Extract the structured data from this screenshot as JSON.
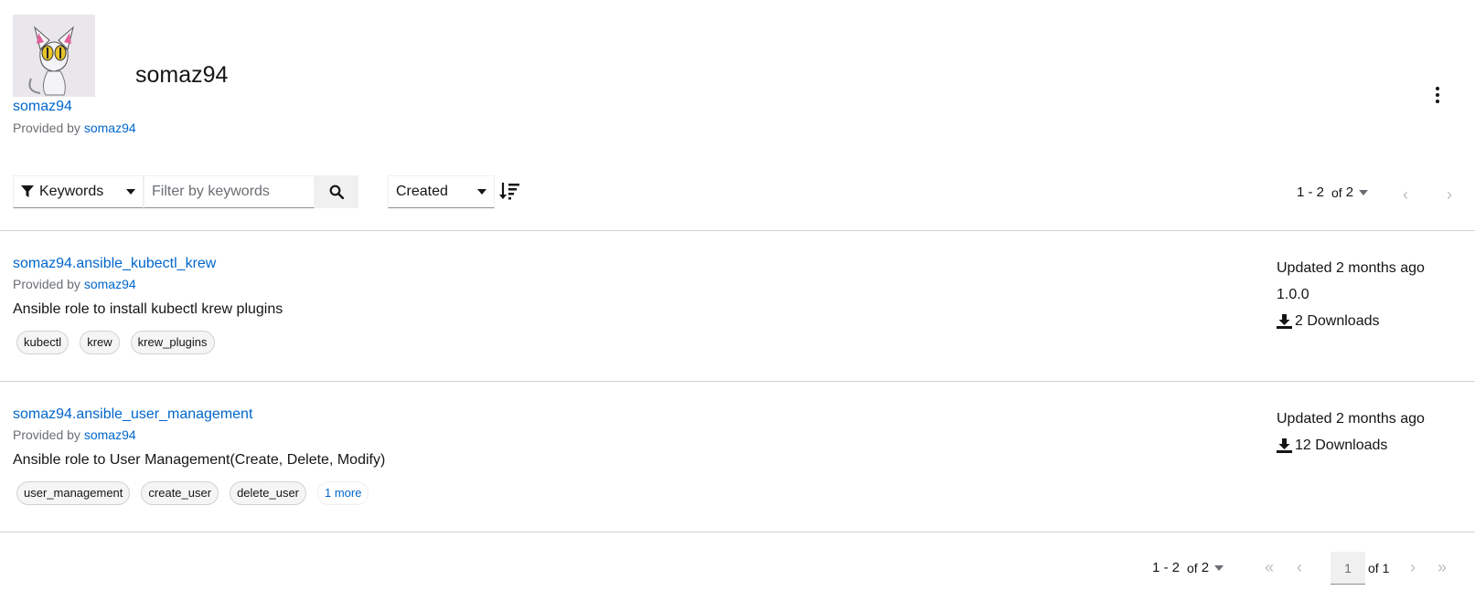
{
  "header": {
    "title": "somaz94",
    "owner_link": "somaz94",
    "provided_by_label": "Provided by",
    "provided_by_name": "somaz94"
  },
  "toolbar": {
    "filter_label": "Keywords",
    "search_placeholder": "Filter by keywords",
    "sort_label": "Created"
  },
  "pagination": {
    "range": "1 - 2",
    "of_label": "of",
    "total": "2",
    "current_page": "1",
    "page_of_label": "of 1"
  },
  "items": [
    {
      "name": "somaz94.ansible_kubectl_krew",
      "provided_by_label": "Provided by",
      "provided_by_name": "somaz94",
      "description": "Ansible role to install kubectl krew plugins",
      "tags": [
        "kubectl",
        "krew",
        "krew_plugins"
      ],
      "updated": "Updated 2 months ago",
      "version": "1.0.0",
      "downloads": "2 Downloads"
    },
    {
      "name": "somaz94.ansible_user_management",
      "provided_by_label": "Provided by",
      "provided_by_name": "somaz94",
      "description": "Ansible role to User Management(Create, Delete, Modify)",
      "tags": [
        "user_management",
        "create_user",
        "delete_user"
      ],
      "more_tags": "1 more",
      "updated": "Updated 2 months ago",
      "downloads": "12 Downloads"
    }
  ],
  "icons": {
    "filter": "filter-icon",
    "search": "search-icon",
    "sort": "sort-amount-down-icon",
    "kebab": "kebab-menu-icon",
    "download": "download-icon"
  }
}
